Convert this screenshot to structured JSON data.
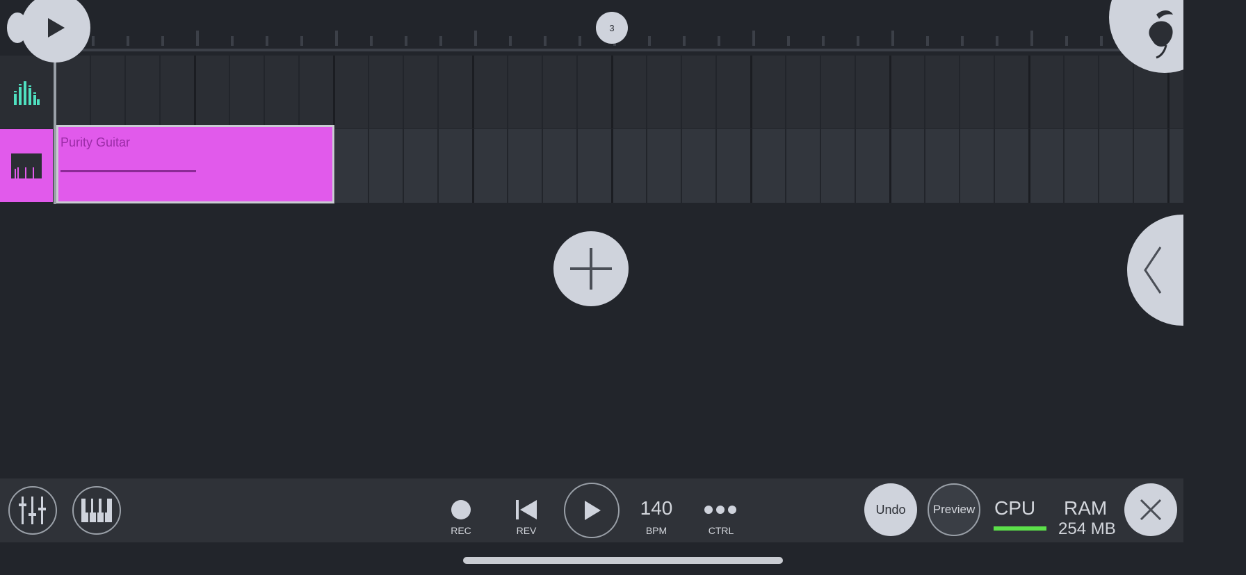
{
  "transport_top": {
    "play_icon": "play-icon"
  },
  "ruler": {
    "position_marker": "3"
  },
  "tracks": [
    {
      "type": "audio",
      "icon": "level-meter-icon",
      "color": "#4fe0c0"
    },
    {
      "type": "instrument",
      "icon": "piano-keys-icon",
      "color": "#e15aeb"
    }
  ],
  "clip": {
    "title": "Purity Guitar",
    "color": "#e15aeb"
  },
  "bottom": {
    "rec_label": "REC",
    "rev_label": "REV",
    "bpm_value": "140",
    "bpm_label": "BPM",
    "ctrl_label": "CTRL",
    "undo_label": "Undo",
    "preview_label": "Preview",
    "cpu_label": "CPU",
    "ram_label": "RAM",
    "ram_value": "254 MB"
  },
  "colors": {
    "accent": "#e15aeb",
    "cpu_meter": "#5ce04a",
    "background": "#22252b"
  }
}
